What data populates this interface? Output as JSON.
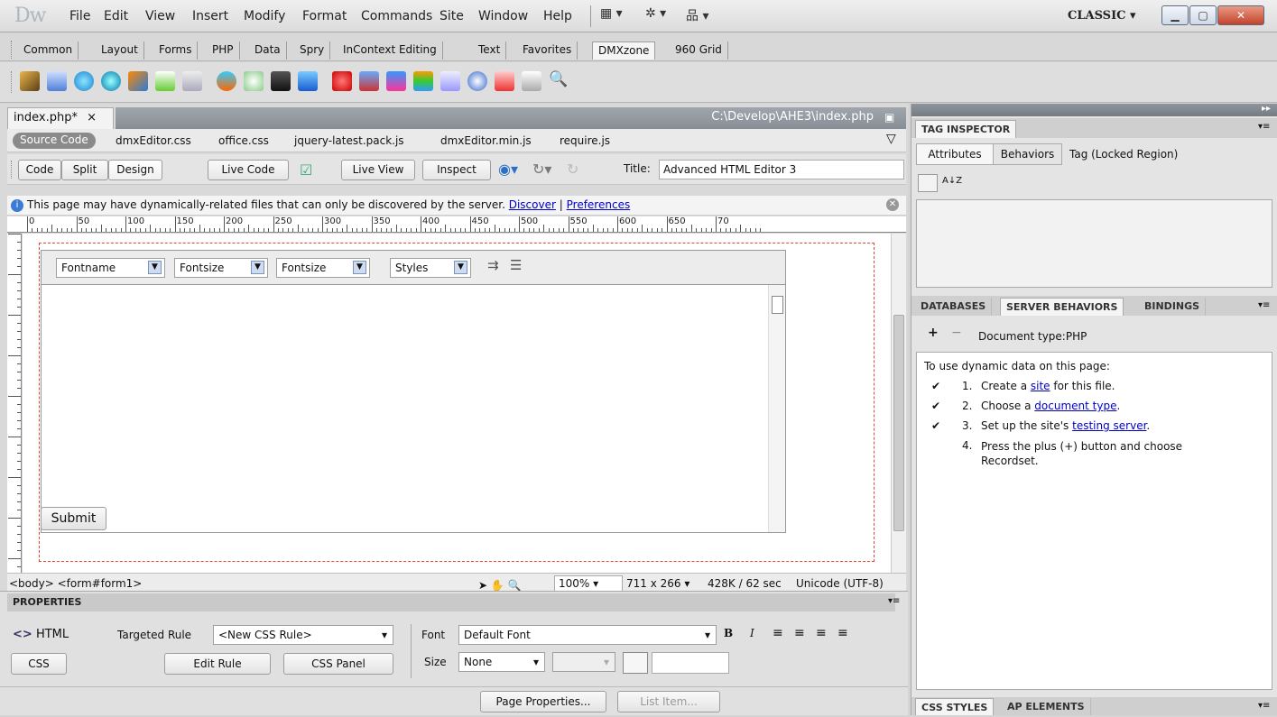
{
  "app": {
    "logo": "Dw",
    "workspace": "CLASSIC"
  },
  "menu": [
    "File",
    "Edit",
    "View",
    "Insert",
    "Modify",
    "Format",
    "Commands",
    "Site",
    "Window",
    "Help"
  ],
  "insert_tabs": [
    "Common",
    "Layout",
    "Forms",
    "PHP",
    "Data",
    "Spry",
    "InContext Editing",
    "Text",
    "Favorites",
    "DMXzone",
    "960 Grid"
  ],
  "insert_active": "DMXzone",
  "document": {
    "tab_label": "index.php*",
    "path": "C:\\Develop\\AHE3\\index.php",
    "source_code": "Source Code",
    "related_files": [
      "dmxEditor.css",
      "office.css",
      "jquery-latest.pack.js",
      "dmxEditor.min.js",
      "require.js"
    ],
    "view_buttons": [
      "Code",
      "Split",
      "Design",
      "Live Code",
      "Live View",
      "Inspect"
    ],
    "title_label": "Title:",
    "title_value": "Advanced HTML Editor 3",
    "info_text": "This page may have dynamically-related files that can only be discovered by the server.",
    "info_discover": "Discover",
    "info_sep": "|",
    "info_prefs": "Preferences"
  },
  "ruler": {
    "labels": [
      "0",
      "50",
      "100",
      "150",
      "200",
      "250",
      "300",
      "350",
      "400",
      "450",
      "500",
      "550",
      "600",
      "650",
      "70"
    ]
  },
  "editor": {
    "selects": [
      "Fontname",
      "Fontsize",
      "Fontsize",
      "Styles"
    ],
    "submit": "Submit"
  },
  "status": {
    "tags": "<body> <form#form1>",
    "zoom": "100%",
    "size": "711 x 266",
    "download": "428K / 62 sec",
    "encoding": "Unicode (UTF-8)"
  },
  "properties": {
    "header": "PROPERTIES",
    "html_label": "HTML",
    "css_label": "CSS",
    "targeted_rule_label": "Targeted Rule",
    "targeted_rule_value": "<New CSS Rule>",
    "edit_rule": "Edit Rule",
    "css_panel": "CSS Panel",
    "font_label": "Font",
    "font_value": "Default Font",
    "size_label": "Size",
    "size_value": "None",
    "page_properties": "Page Properties...",
    "list_item": "List Item...",
    "bold": "B",
    "italic": "I"
  },
  "tag_inspector": {
    "header": "TAG INSPECTOR",
    "tabs": [
      "Attributes",
      "Behaviors"
    ],
    "tag_label": "Tag (Locked Region)",
    "sort_glyph": "A↓Z"
  },
  "server_panel": {
    "tabs": [
      "DATABASES",
      "SERVER BEHAVIORS",
      "BINDINGS"
    ],
    "doc_type": "Document type:PHP",
    "intro": "To use dynamic data on this page:",
    "steps": [
      {
        "n": "1.",
        "pre": "Create a ",
        "link": "site",
        "post": " for this file.",
        "check": true
      },
      {
        "n": "2.",
        "pre": "Choose a ",
        "link": "document type",
        "post": ".",
        "check": true
      },
      {
        "n": "3.",
        "pre": "Set up the site's ",
        "link": "testing server",
        "post": ".",
        "check": true
      },
      {
        "n": "4.",
        "pre": "Press the plus (+) button and choose Recordset.",
        "link": "",
        "post": "",
        "check": false
      }
    ]
  },
  "bottom_tabs": [
    "CSS STYLES",
    "AP ELEMENTS"
  ]
}
